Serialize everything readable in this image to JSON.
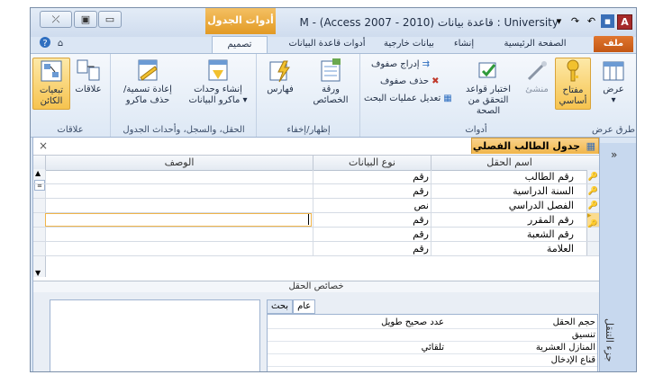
{
  "window": {
    "title": "M - (Access 2007 - 2010) قاعدة بيانات : University",
    "context_group": "أدوات الجدول",
    "controls": {
      "minimize": "▭",
      "restore": "▣",
      "close": "⤫"
    },
    "app_letter": "A"
  },
  "tabs": {
    "file": "ملف",
    "home": "الصفحة الرئيسية",
    "create": "إنشاء",
    "external": "بيانات خارجية",
    "dbtools": "أدوات قاعدة البيانات",
    "design": "تصميم"
  },
  "ribbon": {
    "views": {
      "view": "عرض",
      "group": "طرق عرض"
    },
    "tools": {
      "primary_key": "مفتاح أساسي",
      "builder": "منشئ",
      "test_rules": "اختبار قواعد التحقق من الصحة",
      "insert_rows": "إدراج صفوف",
      "delete_rows": "حذف صفوف",
      "modify_lookups": "تعديل عمليات البحث",
      "group": "أدوات"
    },
    "show_hide": {
      "property_sheet": "ورقة الخصائص",
      "indexes": "فهارس",
      "group": "إظهار/إخفاء"
    },
    "events": {
      "create_macros": "إنشاء وحدات ماكرو البيانات",
      "rename_macro": "إعادة تسمية/حذف ماكرو",
      "group": "الحقل، والسجل، وأحداث الجدول"
    },
    "relationships": {
      "relationships": "علاقات",
      "dependencies": "تبعيات الكائن",
      "group": "علاقات"
    }
  },
  "document": {
    "tab_title": "جدول الطالب الفصلي",
    "close": "×",
    "nav_pane_label": "جزء التنقل",
    "columns": {
      "field_name": "اسم الحقل",
      "data_type": "نوع البيانات",
      "description": "الوصف"
    },
    "rows": [
      {
        "name": "رقم الطالب",
        "type": "رقم",
        "key": true
      },
      {
        "name": "السنة الدراسية",
        "type": "رقم",
        "key": true
      },
      {
        "name": "الفصل الدراسي",
        "type": "نص",
        "key": true
      },
      {
        "name": "رقم المقرر",
        "type": "رقم",
        "key": true,
        "selected": true
      },
      {
        "name": "رقم الشعبة",
        "type": "رقم",
        "key": false
      },
      {
        "name": "العلامة",
        "type": "رقم",
        "key": false
      }
    ],
    "field_properties": "خصائص الحقل",
    "prop_tabs": {
      "general": "عام",
      "lookup": "بحث"
    },
    "props": [
      {
        "name": "حجم الحقل",
        "value": "عدد صحيح طويل"
      },
      {
        "name": "تنسيق",
        "value": ""
      },
      {
        "name": "المنازل العشرية",
        "value": "تلقائي"
      },
      {
        "name": "قناع الإدخال",
        "value": ""
      }
    ]
  }
}
